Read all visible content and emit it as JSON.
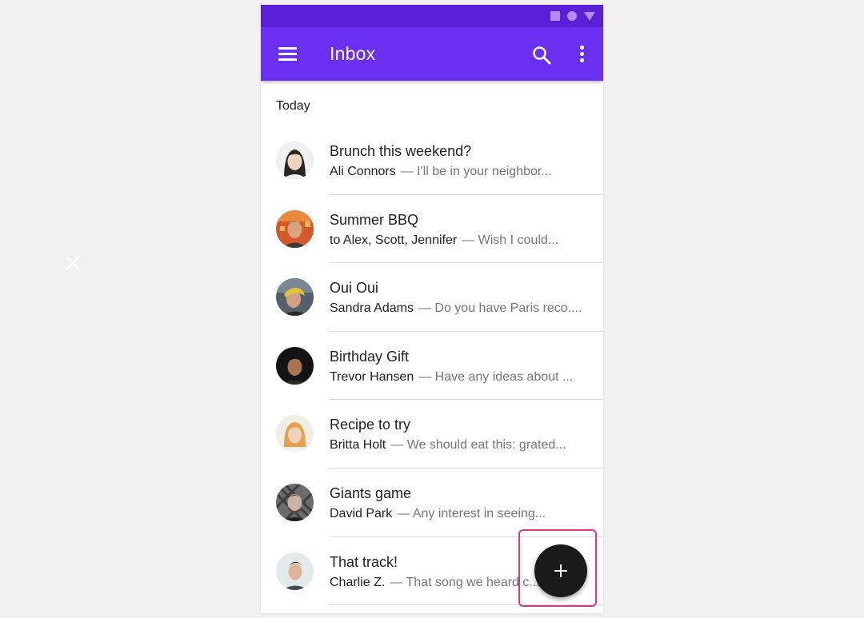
{
  "app_bar": {
    "title": "Inbox",
    "color": "#6a2ff0",
    "status_bar_color": "#5a1fd6"
  },
  "icons": {
    "menu": "menu-icon",
    "search": "search-icon",
    "more": "more-vert-icon",
    "fab": "add-icon",
    "close": "close-icon"
  },
  "section_header": "Today",
  "emails": [
    {
      "subject": "Brunch this weekend?",
      "sender": "Ali Connors",
      "snippet": "— I'll be in your neighbor..."
    },
    {
      "subject": "Summer BBQ",
      "sender": "to Alex, Scott, Jennifer",
      "snippet": "— Wish I could..."
    },
    {
      "subject": "Oui Oui",
      "sender": "Sandra Adams",
      "snippet": "— Do you have Paris reco...."
    },
    {
      "subject": "Birthday Gift",
      "sender": "Trevor Hansen",
      "snippet": "— Have any ideas about ..."
    },
    {
      "subject": "Recipe to try",
      "sender": "Britta Holt",
      "snippet": "— We should eat this: grated..."
    },
    {
      "subject": "Giants game",
      "sender": "David Park",
      "snippet": "— Any interest in seeing..."
    },
    {
      "subject": "That track!",
      "sender": "Charlie Z.",
      "snippet": "— That song we heard c..."
    }
  ],
  "fab": {
    "color": "#1a1a1a",
    "highlight_color": "#e0338a"
  }
}
